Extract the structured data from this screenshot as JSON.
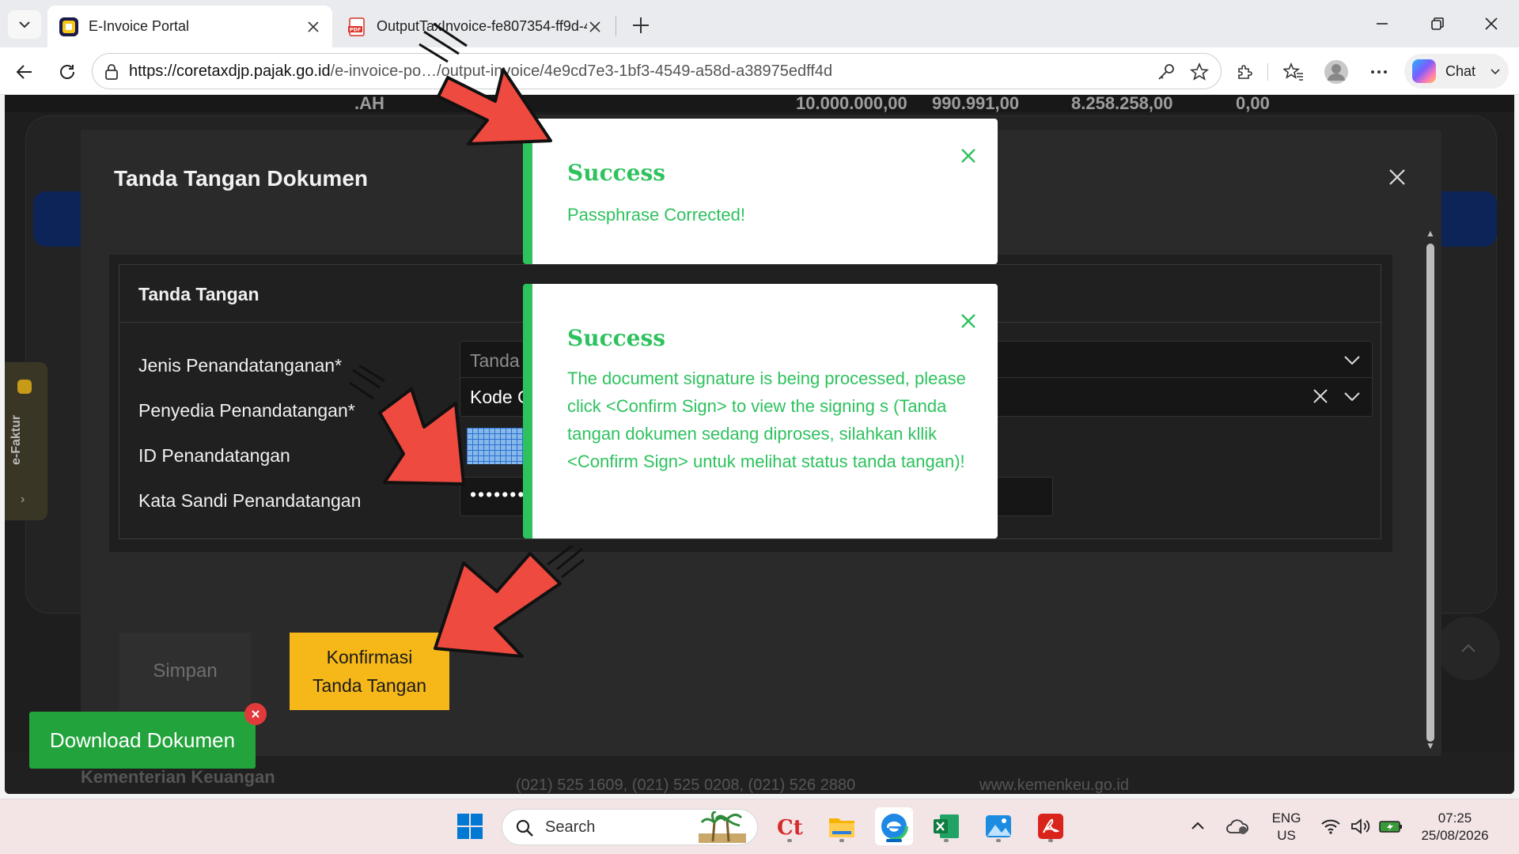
{
  "browser": {
    "tabs": [
      {
        "title": "E-Invoice Portal",
        "active": true,
        "icon": "e-invoice-favicon"
      },
      {
        "title": "OutputTaxInvoice-fe807354-ff9d-4",
        "active": false,
        "icon": "pdf-favicon"
      }
    ],
    "url_host": "https://coretaxdjp.pajak.go.id",
    "url_path": "/e-invoice-po…/output-invoice/4e9cd7e3-1bf3-4549-a58d-a38975edff4d",
    "chat_label": "Chat"
  },
  "background_page": {
    "row_label": ".AH",
    "totals": [
      "10.000.000,00",
      "990.991,00",
      "8.258.258,00",
      "0,00"
    ],
    "side_tab_label": "e-Faktur",
    "footer_brand": "Kementerian Keuangan",
    "footer_phone": "(021) 525 1609, (021) 525 0208, (021) 526 2880",
    "footer_web": "www.kemenkeu.go.id"
  },
  "modal": {
    "title": "Tanda Tangan Dokumen",
    "section_title": "Tanda Tangan",
    "fields": [
      {
        "label": "Jenis Penandatanganan*",
        "value": "Tanda T"
      },
      {
        "label": "Penyedia Penandatangan*",
        "value": "Kode O"
      },
      {
        "label": "ID Penandatangan",
        "value": ""
      },
      {
        "label": "Kata Sandi Penandatangan",
        "value": "••••••••"
      }
    ],
    "btn_save": "Simpan",
    "btn_confirm": "Konfirmasi Tanda Tangan"
  },
  "download_button": "Download Dokumen",
  "toasts": [
    {
      "title": "Success",
      "message": "Passphrase Corrected!"
    },
    {
      "title": "Success",
      "message": "The document signature is being processed, please click <Confirm Sign> to view the signing s (Tanda tangan dokumen sedang diproses, silahkan kllik <Confirm Sign> untuk melihat status tanda tangan)!"
    }
  ],
  "taskbar": {
    "search_placeholder": "Search",
    "lang_line1": "ENG",
    "lang_line2": "US",
    "time": "07:25",
    "date": "25/08/2026"
  },
  "colors": {
    "success": "#2ec25e",
    "confirm_button": "#f5b818",
    "download_button": "#22a33b",
    "arrow": "#ef4a3f"
  }
}
